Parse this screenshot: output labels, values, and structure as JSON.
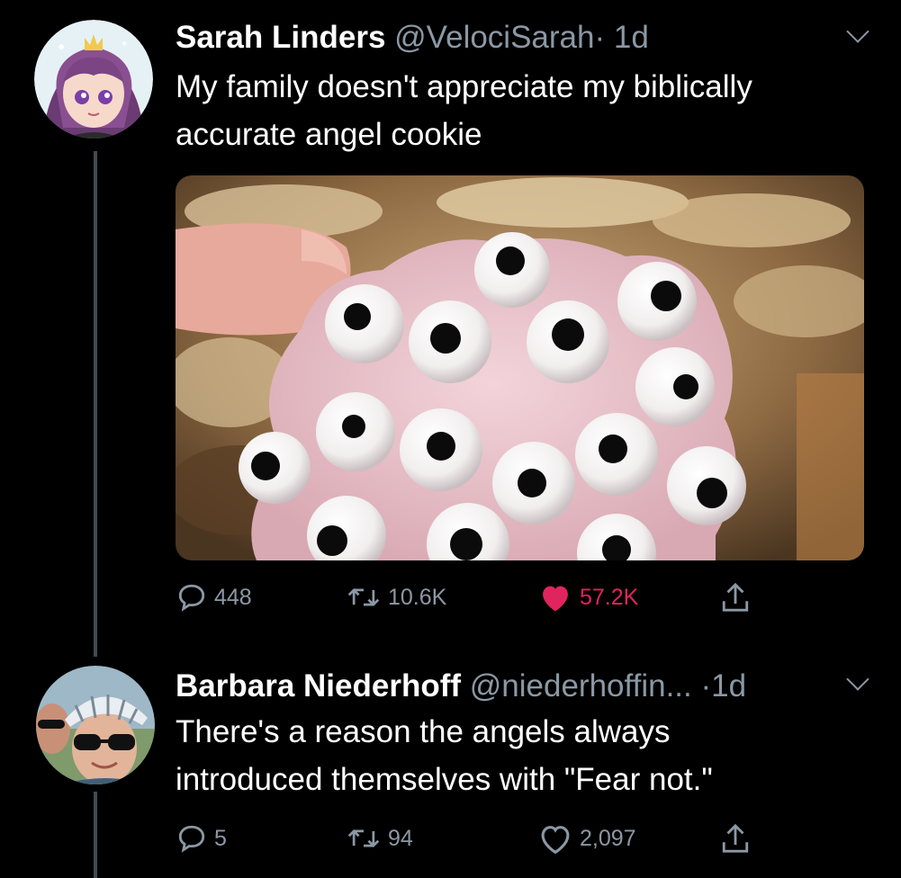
{
  "tweets": [
    {
      "author_name": "Sarah Linders",
      "handle": "@VelociSarah",
      "separator": "·",
      "time": "1d",
      "text_line1": "My family doesn't appreciate my biblically",
      "text_line2": "accurate angel cookie",
      "has_media": true,
      "media_description": "pink frosted cookie covered with candy googly eyes",
      "replies": "448",
      "retweets": "10.6K",
      "likes": "57.2K",
      "liked": true
    },
    {
      "author_name": "Barbara Niederhoff",
      "handle": "@niederhoffin...",
      "separator": "·",
      "time": "1d",
      "text_line1": "There's a reason the angels always",
      "text_line2": "introduced themselves with \"Fear not.\"",
      "has_media": false,
      "replies": "5",
      "retweets": "94",
      "likes": "2,097",
      "liked": false
    }
  ],
  "icons": [
    "reply-icon",
    "retweet-icon",
    "heart-icon",
    "share-icon",
    "chevron-down-icon"
  ],
  "colors": {
    "background": "#000000",
    "text": "#ffffff",
    "muted": "#8b98a5",
    "like": "#e0245e",
    "thread_line": "#444a50"
  }
}
